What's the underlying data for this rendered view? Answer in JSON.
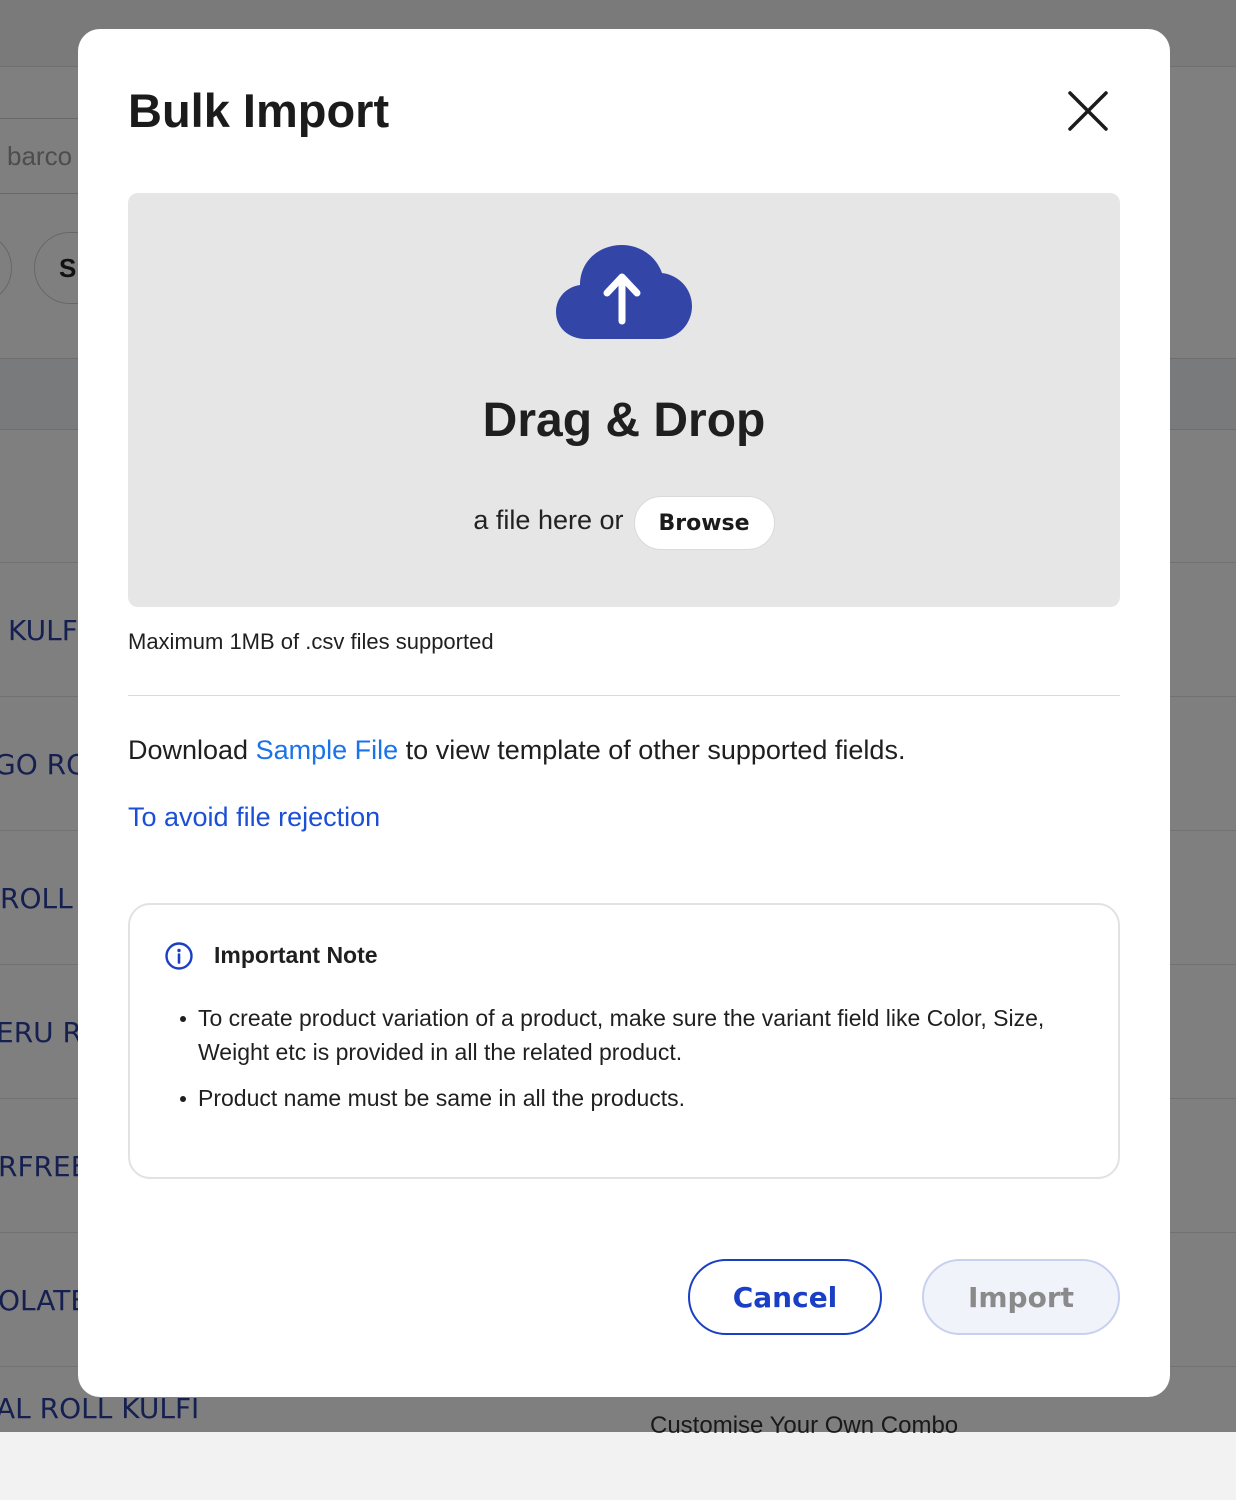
{
  "background": {
    "search_placeholder": "barco",
    "filter_pill": "S",
    "rows": [
      "KULFI",
      "GO ROL",
      "ROLL",
      "ERU RO",
      "RFREE",
      "OLATE",
      "AL ROLL KULFI"
    ],
    "right_text": "Customise Your Own Combo"
  },
  "modal": {
    "title": "Bulk Import",
    "close_icon": "close-icon",
    "dropzone": {
      "icon": "cloud-upload-icon",
      "title": "Drag & Drop",
      "subtitle": "a file here or",
      "browse_label": "Browse"
    },
    "max_note": "Maximum 1MB of .csv files supported",
    "download": {
      "prefix": "Download",
      "link": "Sample File",
      "suffix": "to view template of other supported fields."
    },
    "avoid_link": "To avoid file rejection",
    "note": {
      "icon": "info-icon",
      "title": "Important Note",
      "items": [
        "To create product variation of a product, make sure the variant field like Color, Size, Weight etc is provided in all the related product.",
        "Product name must be same in all the products."
      ]
    },
    "buttons": {
      "cancel": "Cancel",
      "import": "Import"
    }
  },
  "colors": {
    "accent": "#1a3fc4",
    "link": "#1a73e8",
    "icon": "#3346a8"
  }
}
